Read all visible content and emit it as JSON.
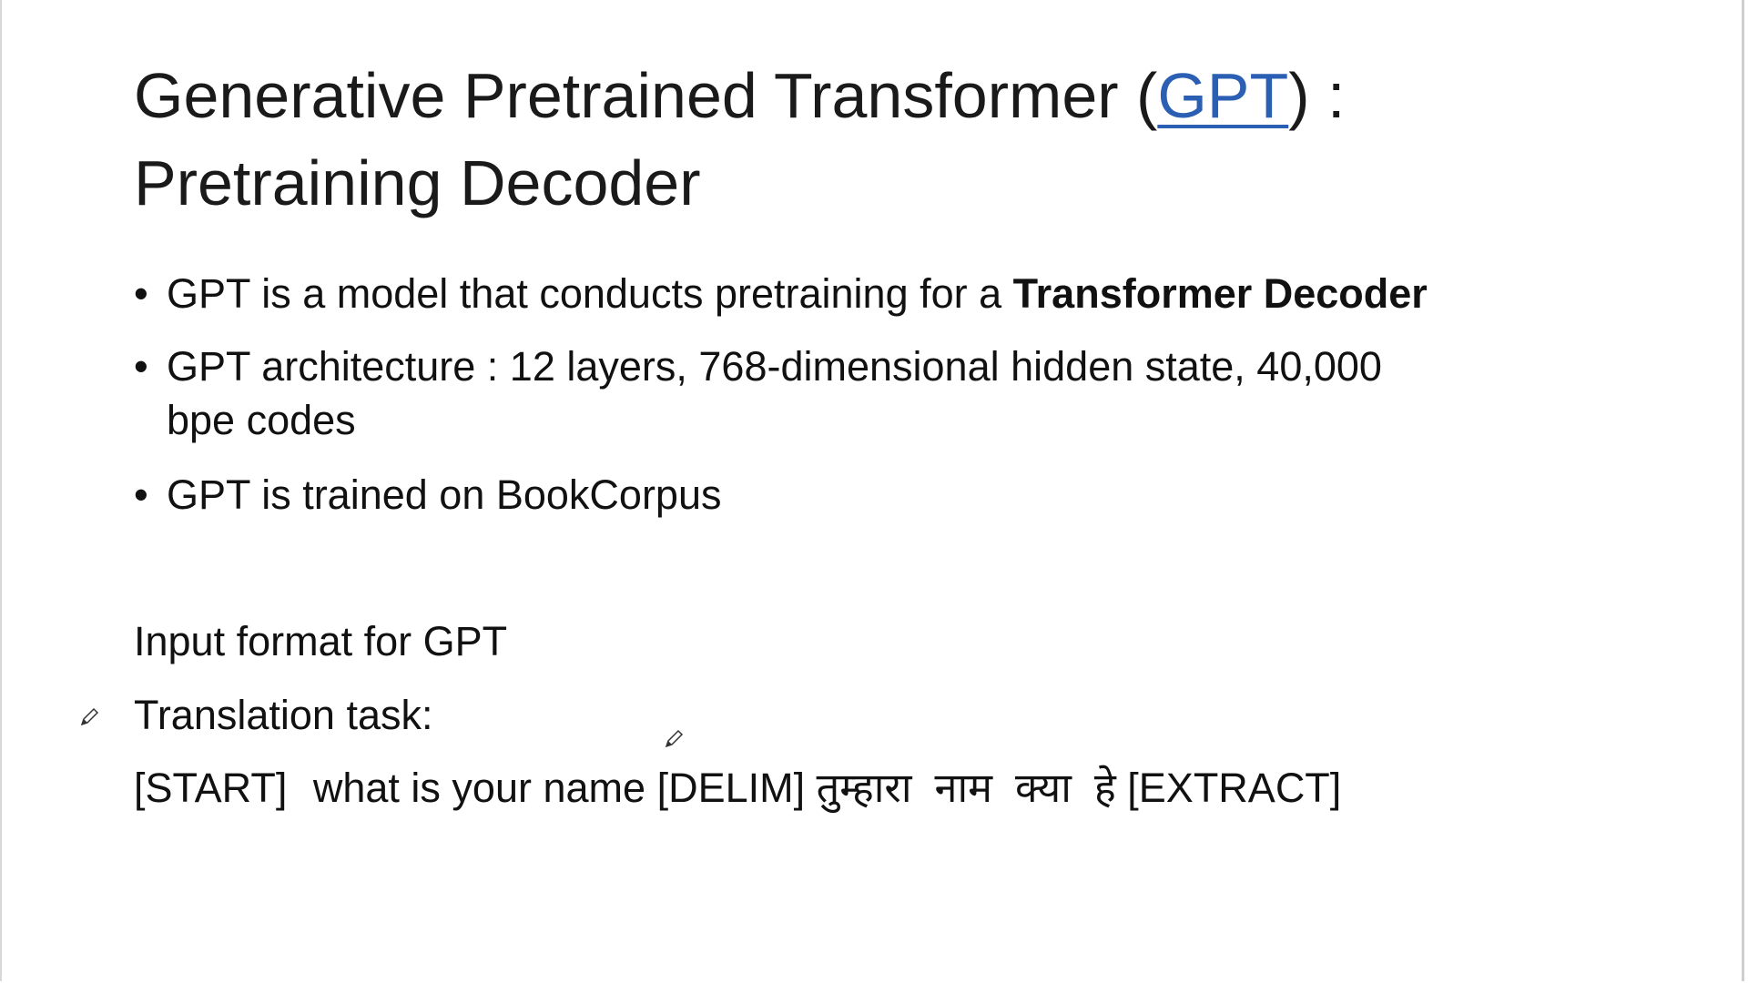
{
  "slide": {
    "title_line1_prefix": "Generative Pretrained Transformer (",
    "title_link": "GPT",
    "title_line1_suffix": ") :",
    "title_line2": "Pretraining Decoder",
    "bullets": [
      {
        "text": "GPT is a model that conducts pretraining for a ",
        "bold": "Transformer Decoder"
      },
      {
        "text": "GPT architecture : 12 layers, 768-dimensional hidden state, 40,000",
        "text2": "bpe codes"
      },
      {
        "text": "GPT is trained on BookCorpus"
      }
    ],
    "input_format_heading": "Input format for GPT",
    "task_label": "Translation task:",
    "example": {
      "start": "[START]",
      "source": "what is your name",
      "delim": "[DELIM]",
      "target": "तुम्हारा  नाम  क्या  हे",
      "extract": "[EXTRACT]"
    }
  },
  "colors": {
    "link": "#2b5fb4",
    "text": "#111111"
  }
}
